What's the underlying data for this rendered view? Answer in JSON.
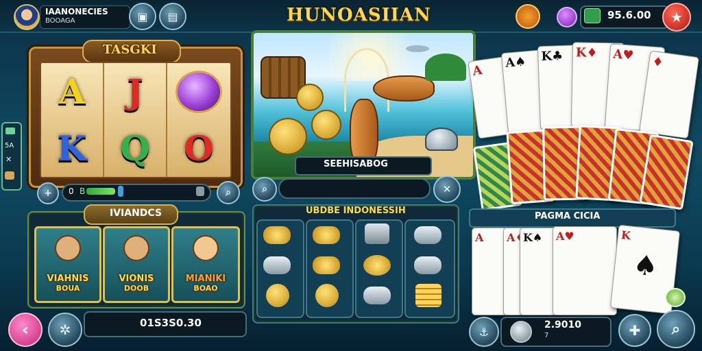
{
  "header": {
    "player_name": "IAANONECIES",
    "player_sub": "BOOAGA",
    "game_title": "HUNOASIIAN",
    "currency_value": "95.6.00"
  },
  "slots": {
    "title": "TASGKI",
    "symbols": [
      {
        "label": "A",
        "color": "#f2d21c"
      },
      {
        "label": "J",
        "color": "#e02a24"
      },
      {
        "label": "",
        "color": "#9b3fd6"
      },
      {
        "label": "K",
        "color": "#2f63e0"
      },
      {
        "label": "Q",
        "color": "#2fb34a"
      },
      {
        "label": "O",
        "color": "#e02a24"
      }
    ],
    "meter_value": "0",
    "meter_mark": "B"
  },
  "fishing": {
    "label": "SEEHISABOG"
  },
  "mandcs": {
    "title": "IVIANDCS",
    "characters": [
      {
        "line1": "VIAHNIS",
        "line2": "BOUA"
      },
      {
        "line1": "VIONIS",
        "line2": "DOOB"
      },
      {
        "line1": "MIANIKI",
        "line2": "BOAO"
      }
    ]
  },
  "indonesia": {
    "title": "UBDBE INDONESSIH"
  },
  "cards_panel": {
    "title": "PAGMA CICIA"
  },
  "bottom": {
    "balance": "01S3S0.30",
    "bet_value": "2.9010",
    "bet_sub": "7"
  }
}
